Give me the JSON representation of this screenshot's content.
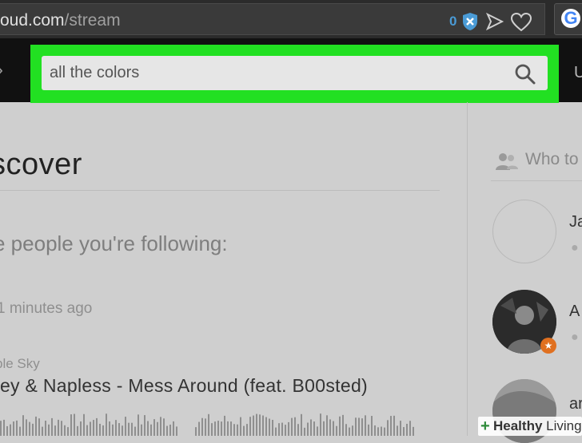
{
  "browser": {
    "url_domain": "oud.com",
    "url_path": "/stream",
    "extension_count": "0",
    "tab_letter": "G"
  },
  "header": {
    "search_value": "all the colors",
    "upload_label": "U"
  },
  "main": {
    "discover_heading": "scover",
    "following_heading": "e people you're following:",
    "time_ago": "1 minutes ago",
    "artist": "ple Sky",
    "track_title": "rey & Napless - Mess Around (feat. B00sted)"
  },
  "sidebar": {
    "who_to_follow": "Who to",
    "users": [
      {
        "name": "Ja"
      },
      {
        "name": "A"
      },
      {
        "name": "ar"
      }
    ]
  },
  "watermark": {
    "brand": "Healthy",
    "suffix": " Living"
  },
  "colors": {
    "highlight": "#22e022",
    "site_header": "#111111",
    "page_bg": "#cfcfcf"
  }
}
